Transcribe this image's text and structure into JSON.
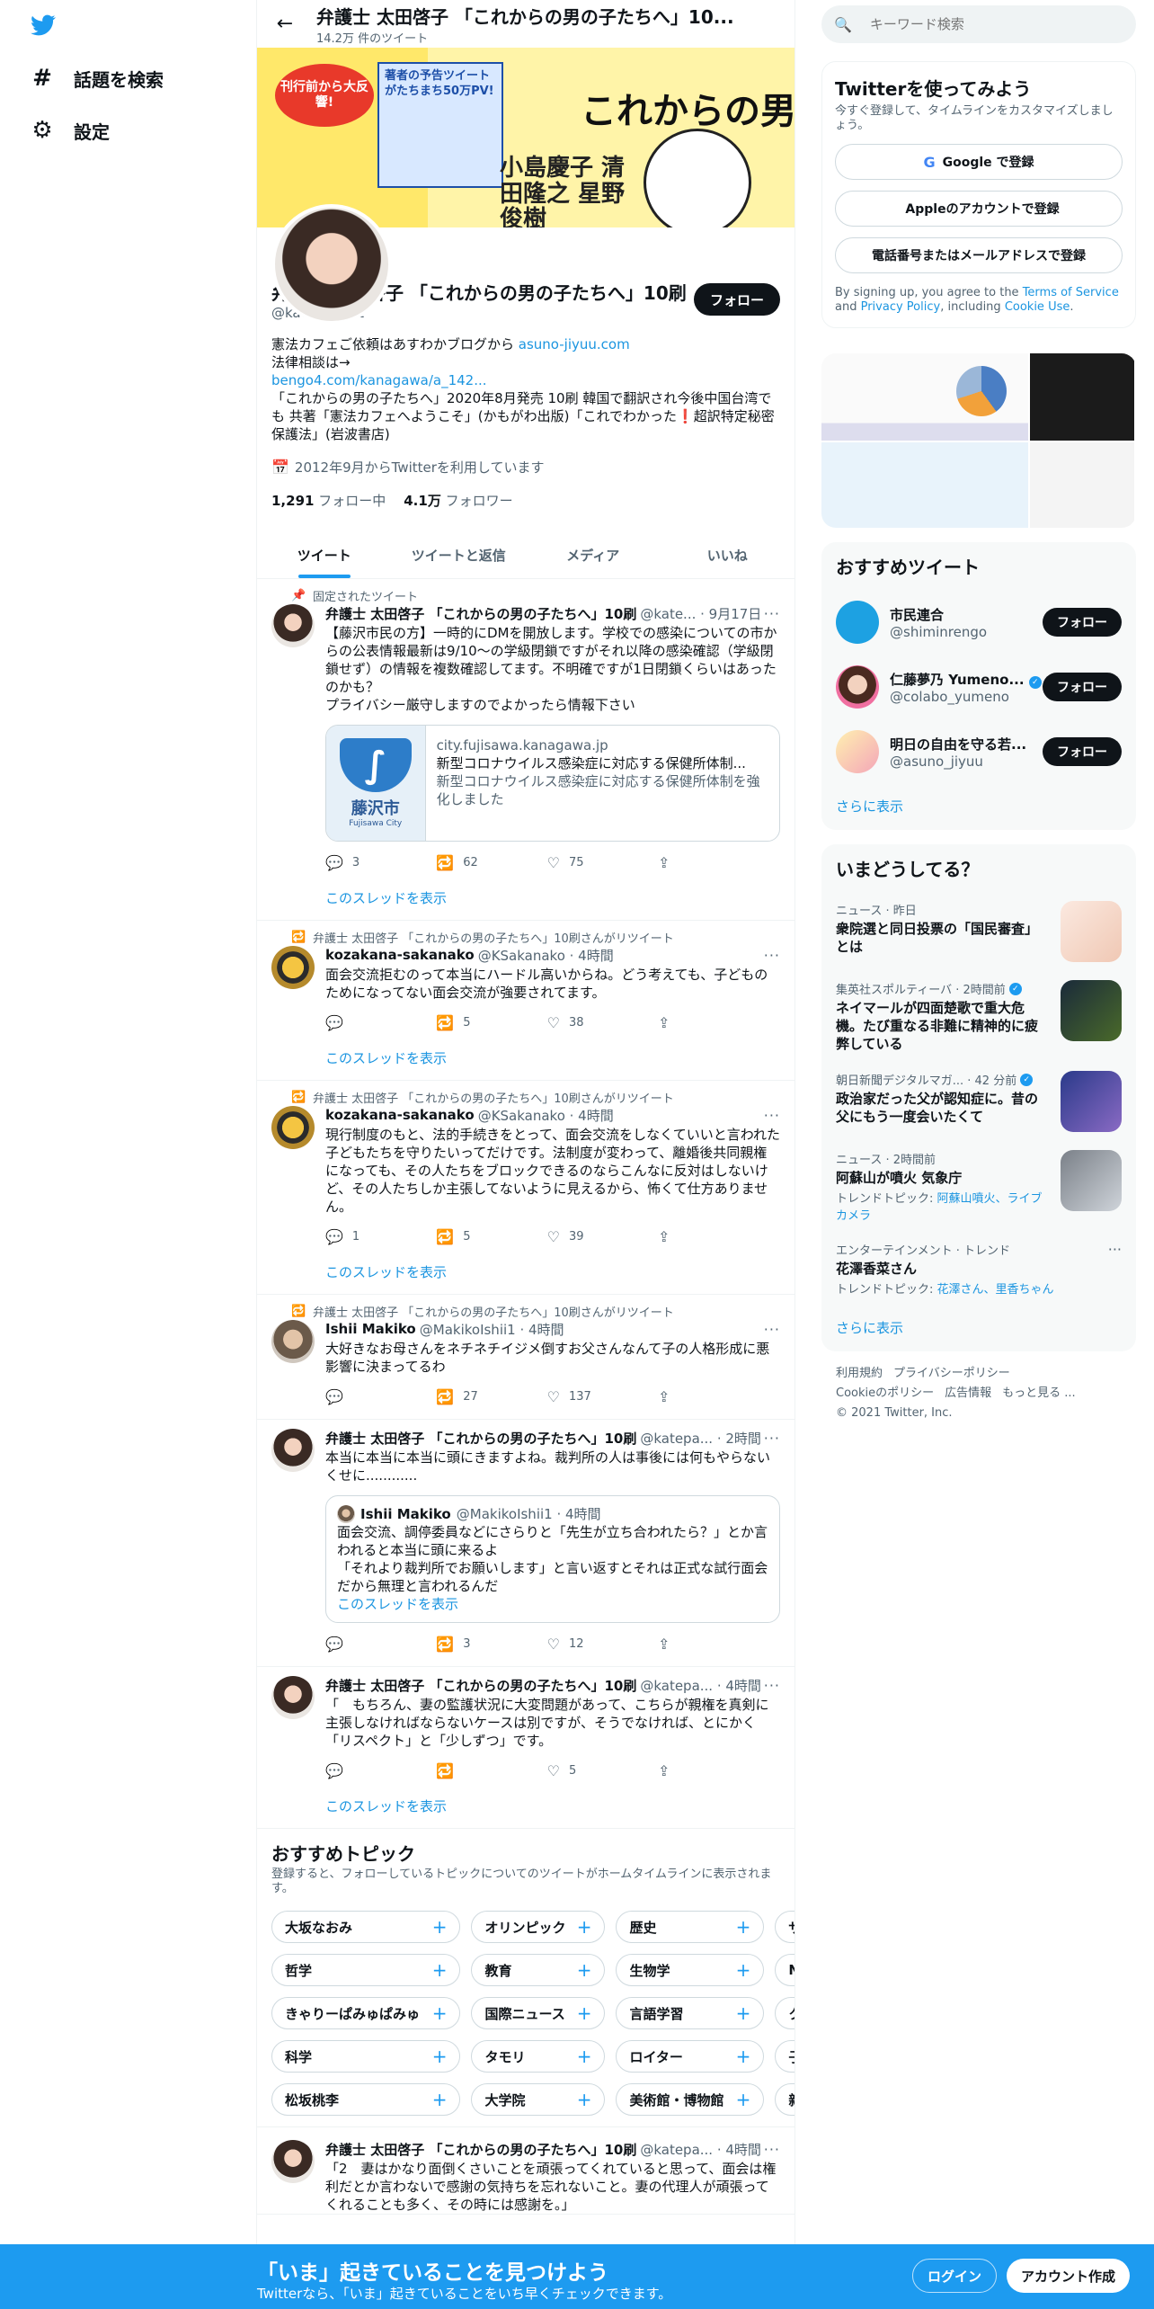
{
  "nav": {
    "logo_icon": "twitter-bird-icon",
    "explore_label": "話題を検索",
    "settings_label": "設定"
  },
  "header": {
    "name": "弁護士 太田啓子 「これからの男の子たちへ」10...",
    "tweet_count": "14.2万 件のツイート"
  },
  "banner": {
    "bubble": "刊行前から大反響!",
    "box_text": "著者の予告ツイートがたちまち50万PV!",
    "title": "これからの男の子たちへ",
    "names": "小島慶子 清田隆之 星野俊樹"
  },
  "profile": {
    "follow_label": "フォロー",
    "name": "弁護士 太田啓子 「これからの男の子たちへ」10刷",
    "handle": "@katepanda2",
    "bio_line1_text": "憲法カフェご依頼はあすわかブログから ",
    "bio_line1_link": "asuno-jiyuu.com",
    "bio_line2": "法律相談は→",
    "bio_line3_link": "bengo4.com/kanagawa/a_142...",
    "bio_line4": "「これからの男の子たちへ」2020年8月発売 10刷 韓国で翻訳され今後中国台湾でも 共著「憲法カフェへようこそ」(かもがわ出版)「これでわかった❗️超訳特定秘密保護法」(岩波書店)",
    "joined": "2012年9月からTwitterを利用しています",
    "following_count": "1,291",
    "following_label": "フォロー中",
    "followers_count": "4.1万",
    "followers_label": "フォロワー"
  },
  "tabs": [
    "ツイート",
    "ツイートと返信",
    "メディア",
    "いいね"
  ],
  "tweets": [
    {
      "context": "固定されたツイート",
      "name": "弁護士 太田啓子 「これからの男の子たちへ」10刷",
      "meta": "@kate... · 9月17日",
      "text": "【藤沢市民の方】一時的にDMを開放します。学校での感染についての市からの公表情報最新は9/10～の学級閉鎖ですがそれ以降の感染確認（学級閉鎖せず）の情報を複数確認してます。不明確ですが1日閉鎖くらいはあったのかも？\nプライバシー厳守しますのでよかったら情報下さい",
      "card": {
        "city": "藤沢市",
        "city_en": "Fujisawa City",
        "domain": "city.fujisawa.kanagawa.jp",
        "title": "新型コロナウイルス感染症に対応する保健所体制...",
        "desc": "新型コロナウイルス感染症に対応する保健所体制を強化しました"
      },
      "replies": "3",
      "retweets": "62",
      "likes": "75",
      "show_thread": "このスレッドを表示"
    },
    {
      "context": "弁護士 太田啓子 「これからの男の子たちへ」10刷さんがリツイート",
      "name": "kozakana-sakanako",
      "meta": "@KSakanako · 4時間",
      "text": "面会交流拒むのって本当にハードル高いからね。どう考えても、子どものためになってない面会交流が強要されてます。",
      "replies": "",
      "retweets": "5",
      "likes": "38",
      "show_thread": "このスレッドを表示"
    },
    {
      "context": "弁護士 太田啓子 「これからの男の子たちへ」10刷さんがリツイート",
      "name": "kozakana-sakanako",
      "meta": "@KSakanako · 4時間",
      "text": "現行制度のもと、法的手続きをとって、面会交流をしなくていいと言われた子どもたちを守りたいってだけです。法制度が変わって、離婚後共同親権になっても、その人たちをブロックできるのならこんなに反対はしないけど、その人たちしか主張してないように見えるから、怖くて仕方ありません。",
      "replies": "1",
      "retweets": "5",
      "likes": "39",
      "show_thread": "このスレッドを表示"
    },
    {
      "context": "弁護士 太田啓子 「これからの男の子たちへ」10刷さんがリツイート",
      "name": "Ishii Makiko",
      "meta": "@MakikoIshii1 · 4時間",
      "text": "大好きなお母さんをネチネチイジメ倒すお父さんなんて子の人格形成に悪影響に決まってるわ",
      "replies": "",
      "retweets": "27",
      "likes": "137"
    },
    {
      "name": "弁護士 太田啓子 「これからの男の子たちへ」10刷",
      "meta": "@katepa... · 2時間",
      "text": "本当に本当に本当に頭にきますよね。裁判所の人は事後には何もやらないくせに............",
      "quote": {
        "name": "Ishii Makiko",
        "meta": "@MakikoIshii1 · 4時間",
        "text": "面会交流、調停委員などにさらりと「先生が立ち合われたら？」とか言われると本当に頭に来るよ\n「それより裁判所でお願いします」と言い返すとそれは正式な試行面会だから無理と言われるんだ",
        "link": "このスレッドを表示"
      },
      "replies": "",
      "retweets": "3",
      "likes": "12"
    },
    {
      "name": "弁護士 太田啓子 「これからの男の子たちへ」10刷",
      "meta": "@katepa... · 4時間",
      "text": "「　もちろん、妻の監護状況に大変問題があって、こちらが親権を真剣に主張しなければならないケースは別ですが、そうでなければ、とにかく「リスペクト」と「少しずつ」です。",
      "replies": "",
      "retweets": "",
      "likes": "5",
      "show_thread": "このスレッドを表示"
    }
  ],
  "topics": {
    "title": "おすすめトピック",
    "subtitle": "登録すると、フォローしているトピックについてのツイートがホームタイムラインに表示されます。",
    "rows": [
      [
        "大坂なおみ",
        "オリンピック",
        "歴史",
        "ザ"
      ],
      [
        "哲学",
        "教育",
        "生物学",
        "NH"
      ],
      [
        "きゃりーぱみゅぱみゅ",
        "国際ニュース",
        "言語学習",
        "ク"
      ],
      [
        "科学",
        "タモリ",
        "ロイター",
        "子"
      ],
      [
        "松坂桃李",
        "大学院",
        "美術館・博物館",
        "新"
      ]
    ]
  },
  "last_tweet": {
    "name": "弁護士 太田啓子 「これからの男の子たちへ」10刷",
    "meta": "@katepa... · 4時間",
    "text": "「2　妻はかなり面倒くさいことを頑張ってくれていると思って、面会は権利だとか言わないで感謝の気持ちを忘れないこと。妻の代理人が頑張ってくれることも多く、その時には感謝を。」"
  },
  "search": {
    "placeholder": "キーワード検索"
  },
  "signup": {
    "title": "Twitterを使ってみよう",
    "subtitle": "今すぐ登録して、タイムラインをカスタマイズしましょう。",
    "google": "Google で登録",
    "apple": "Appleのアカウントで登録",
    "phone": "電話番号またはメールアドレスで登録",
    "terms_pre": "By signing up, you agree to the ",
    "terms_link": "Terms of Service",
    "terms_mid": " and ",
    "privacy_link": "Privacy Policy",
    "terms_mid2": ", including ",
    "cookie_link": "Cookie Use",
    "terms_end": "."
  },
  "recommended": {
    "title": "おすすめツイート",
    "follow_label": "フォロー",
    "users": [
      {
        "name": "市民連合",
        "handle": "@shiminrengo"
      },
      {
        "name": "仁藤夢乃 Yumeno...",
        "handle": "@colabo_yumeno"
      },
      {
        "name": "明日の自由を守る若...",
        "handle": "@asuno_jiyuu"
      }
    ],
    "more": "さらに表示"
  },
  "trends": {
    "title": "いまどうしてる？",
    "items": [
      {
        "meta": "ニュース · 昨日",
        "title": "衆院選と同日投票の「国民審査」とは"
      },
      {
        "meta": "集英社スポルティーバ · 2時間前",
        "title": "ネイマールが四面楚歌で重大危機。たび重なる非難に精神的に疲弊している"
      },
      {
        "meta": "朝日新聞デジタルマガ... · 42 分前",
        "title": "政治家だった父が認知症に。昔の父にもう一度会いたくて"
      },
      {
        "meta": "ニュース · 2時間前",
        "title": "阿蘇山が噴火 気象庁",
        "sub_pre": "トレンドトピック: ",
        "sub_link": "阿蘇山噴火、ライブカメラ"
      },
      {
        "meta": "エンターテインメント · トレンド",
        "title": "花澤香菜さん",
        "sub_pre": "トレンドトピック: ",
        "sub_link": "花澤さん、里香ちゃん"
      }
    ],
    "more": "さらに表示"
  },
  "footer": {
    "links_row1": [
      "利用規約",
      "プライバシーポリシー"
    ],
    "links_row2": [
      "Cookieのポリシー",
      "広告情報",
      "もっと見る ..."
    ],
    "copyright": "© 2021 Twitter, Inc."
  },
  "bottombar": {
    "title": "「いま」起きていることを見つけよう",
    "subtitle": "Twitterなら、「いま」起きていることをいち早くチェックできます。",
    "login": "ログイン",
    "signup": "アカウント作成"
  },
  "colors": {
    "accent": "#1d9bf0",
    "link": "#1b95e0",
    "dark": "#0f1419"
  }
}
